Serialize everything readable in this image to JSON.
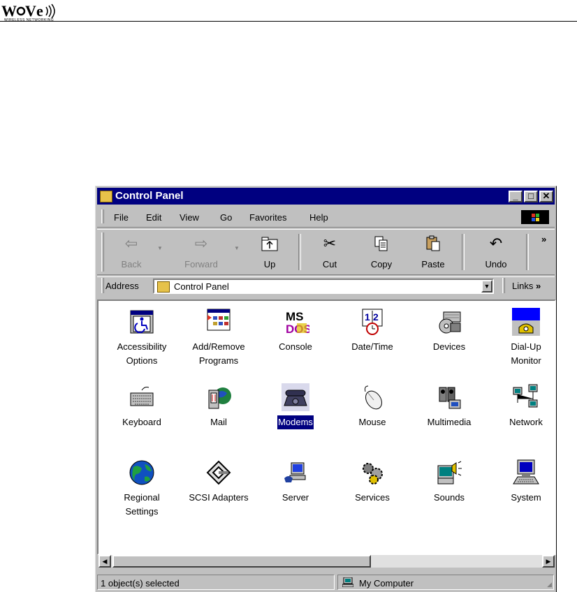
{
  "header": {
    "logo_text": "WAVE",
    "logo_subtitle": "WIRELESS NETWORKING"
  },
  "window": {
    "title": "Control Panel",
    "controls": {
      "minimize": "_",
      "maximize": "□",
      "close": "✕"
    }
  },
  "menu": [
    "File",
    "Edit",
    "View",
    "Go",
    "Favorites",
    "Help"
  ],
  "toolbar": {
    "back": "Back",
    "forward": "Forward",
    "up": "Up",
    "cut": "Cut",
    "copy": "Copy",
    "paste": "Paste",
    "undo": "Undo",
    "more": "»"
  },
  "address": {
    "label": "Address",
    "value": "Control Panel",
    "links_label": "Links",
    "links_more": "»"
  },
  "items": [
    {
      "line1": "Accessibility",
      "line2": "Options",
      "icon": "accessibility-icon"
    },
    {
      "line1": "Add/Remove",
      "line2": "Programs",
      "icon": "add-remove-programs-icon"
    },
    {
      "line1": "Console",
      "line2": "",
      "icon": "console-icon"
    },
    {
      "line1": "Date/Time",
      "line2": "",
      "icon": "date-time-icon"
    },
    {
      "line1": "Devices",
      "line2": "",
      "icon": "devices-icon"
    },
    {
      "line1": "Dial-Up",
      "line2": "Monitor",
      "icon": "dialup-monitor-icon"
    },
    {
      "line1": "Keyboard",
      "line2": "",
      "icon": "keyboard-icon"
    },
    {
      "line1": "Mail",
      "line2": "",
      "icon": "mail-icon"
    },
    {
      "line1": "Modems",
      "line2": "",
      "icon": "modem-icon",
      "selected": true
    },
    {
      "line1": "Mouse",
      "line2": "",
      "icon": "mouse-icon"
    },
    {
      "line1": "Multimedia",
      "line2": "",
      "icon": "multimedia-icon"
    },
    {
      "line1": "Network",
      "line2": "",
      "icon": "network-icon"
    },
    {
      "line1": "Regional",
      "line2": "Settings",
      "icon": "globe-icon"
    },
    {
      "line1": "SCSI Adapters",
      "line2": "",
      "icon": "scsi-icon"
    },
    {
      "line1": "Server",
      "line2": "",
      "icon": "server-icon"
    },
    {
      "line1": "Services",
      "line2": "",
      "icon": "services-icon"
    },
    {
      "line1": "Sounds",
      "line2": "",
      "icon": "sounds-icon"
    },
    {
      "line1": "System",
      "line2": "",
      "icon": "system-icon"
    }
  ],
  "status": {
    "selection": "1 object(s) selected",
    "location": "My Computer"
  },
  "colors": {
    "title_bar": "#000080",
    "window_face": "#c0c0c0",
    "selection": "#000080"
  }
}
